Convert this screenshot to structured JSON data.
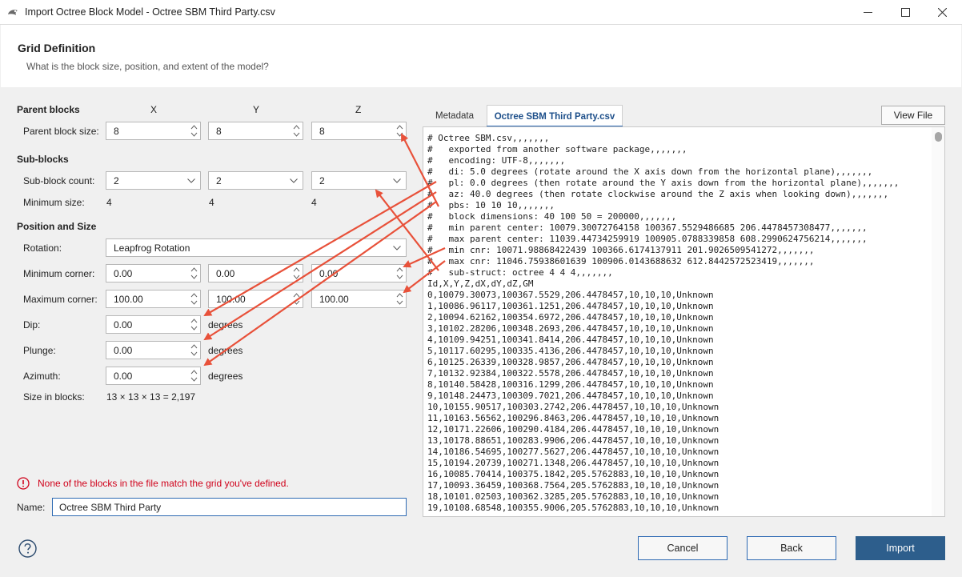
{
  "window": {
    "title": "Import Octree Block Model - Octree SBM Third Party.csv",
    "icons": {
      "app": "leapfrog-icon",
      "minimize": "minimize-icon",
      "maximize": "maximize-icon",
      "close": "close-icon"
    }
  },
  "header": {
    "title": "Grid Definition",
    "subtitle": "What is the block size, position, and extent of the model?"
  },
  "grid": {
    "parent_blocks_heading": "Parent blocks",
    "col_x": "X",
    "col_y": "Y",
    "col_z": "Z",
    "parent_block_size_label": "Parent block size:",
    "parent_block_size": [
      "8",
      "8",
      "8"
    ],
    "sub_blocks_heading": "Sub-blocks",
    "sub_block_count_label": "Sub-block count:",
    "sub_block_count": [
      "2",
      "2",
      "2"
    ],
    "minimum_size_label": "Minimum size:",
    "minimum_size": [
      "4",
      "4",
      "4"
    ],
    "position_heading": "Position and Size",
    "rotation_label": "Rotation:",
    "rotation_value": "Leapfrog Rotation",
    "min_corner_label": "Minimum corner:",
    "min_corner": [
      "0.00",
      "0.00",
      "0.00"
    ],
    "max_corner_label": "Maximum corner:",
    "max_corner": [
      "100.00",
      "100.00",
      "100.00"
    ],
    "dip_label": "Dip:",
    "dip_value": "0.00",
    "plunge_label": "Plunge:",
    "plunge_value": "0.00",
    "azimuth_label": "Azimuth:",
    "azimuth_value": "0.00",
    "degrees": "degrees",
    "size_in_blocks_label": "Size in blocks:",
    "size_in_blocks_value": "13 × 13 × 13 = 2,197"
  },
  "tabs": [
    {
      "label": "Metadata",
      "active": false
    },
    {
      "label": "Octree SBM Third Party.csv",
      "active": true
    }
  ],
  "view_file_label": "View File",
  "file_lines": [
    "# Octree SBM.csv,,,,,,,",
    "#   exported from another software package,,,,,,,",
    "#   encoding: UTF-8,,,,,,,",
    "#   di: 5.0 degrees (rotate around the X axis down from the horizontal plane),,,,,,,",
    "#   pl: 0.0 degrees (then rotate around the Y axis down from the horizontal plane),,,,,,,",
    "#   az: 40.0 degrees (then rotate clockwise around the Z axis when looking down),,,,,,,",
    "#   pbs: 10 10 10,,,,,,,",
    "#   block dimensions: 40 100 50 = 200000,,,,,,,",
    "#   min parent center: 10079.30072764158 100367.5529486685 206.4478457308477,,,,,,,",
    "#   max parent center: 11039.44734259919 100905.0788339858 608.2990624756214,,,,,,,",
    "#   min cnr: 10071.98868422439 100366.6174137911 201.9026509541272,,,,,,,",
    "#   max cnr: 11046.75938601639 100906.0143688632 612.8442572523419,,,,,,,",
    "#   sub-struct: octree 4 4 4,,,,,,,",
    "Id,X,Y,Z,dX,dY,dZ,GM",
    "0,10079.30073,100367.5529,206.4478457,10,10,10,Unknown",
    "1,10086.96117,100361.1251,206.4478457,10,10,10,Unknown",
    "2,10094.62162,100354.6972,206.4478457,10,10,10,Unknown",
    "3,10102.28206,100348.2693,206.4478457,10,10,10,Unknown",
    "4,10109.94251,100341.8414,206.4478457,10,10,10,Unknown",
    "5,10117.60295,100335.4136,206.4478457,10,10,10,Unknown",
    "6,10125.26339,100328.9857,206.4478457,10,10,10,Unknown",
    "7,10132.92384,100322.5578,206.4478457,10,10,10,Unknown",
    "8,10140.58428,100316.1299,206.4478457,10,10,10,Unknown",
    "9,10148.24473,100309.7021,206.4478457,10,10,10,Unknown",
    "10,10155.90517,100303.2742,206.4478457,10,10,10,Unknown",
    "11,10163.56562,100296.8463,206.4478457,10,10,10,Unknown",
    "12,10171.22606,100290.4184,206.4478457,10,10,10,Unknown",
    "13,10178.88651,100283.9906,206.4478457,10,10,10,Unknown",
    "14,10186.54695,100277.5627,206.4478457,10,10,10,Unknown",
    "15,10194.20739,100271.1348,206.4478457,10,10,10,Unknown",
    "16,10085.70414,100375.1842,205.5762883,10,10,10,Unknown",
    "17,10093.36459,100368.7564,205.5762883,10,10,10,Unknown",
    "18,10101.02503,100362.3285,205.5762883,10,10,10,Unknown",
    "19,10108.68548,100355.9006,205.5762883,10,10,10,Unknown"
  ],
  "error_message": "None of the blocks in the file match the grid you've defined.",
  "name_label": "Name:",
  "name_value": "Octree SBM Third Party",
  "buttons": {
    "cancel": "Cancel",
    "back": "Back",
    "import": "Import"
  },
  "colors": {
    "accent": "#2e6ab3",
    "primary_button": "#2d5e8c",
    "error": "#d0021b",
    "annotation_arrow": "#e8513a"
  }
}
